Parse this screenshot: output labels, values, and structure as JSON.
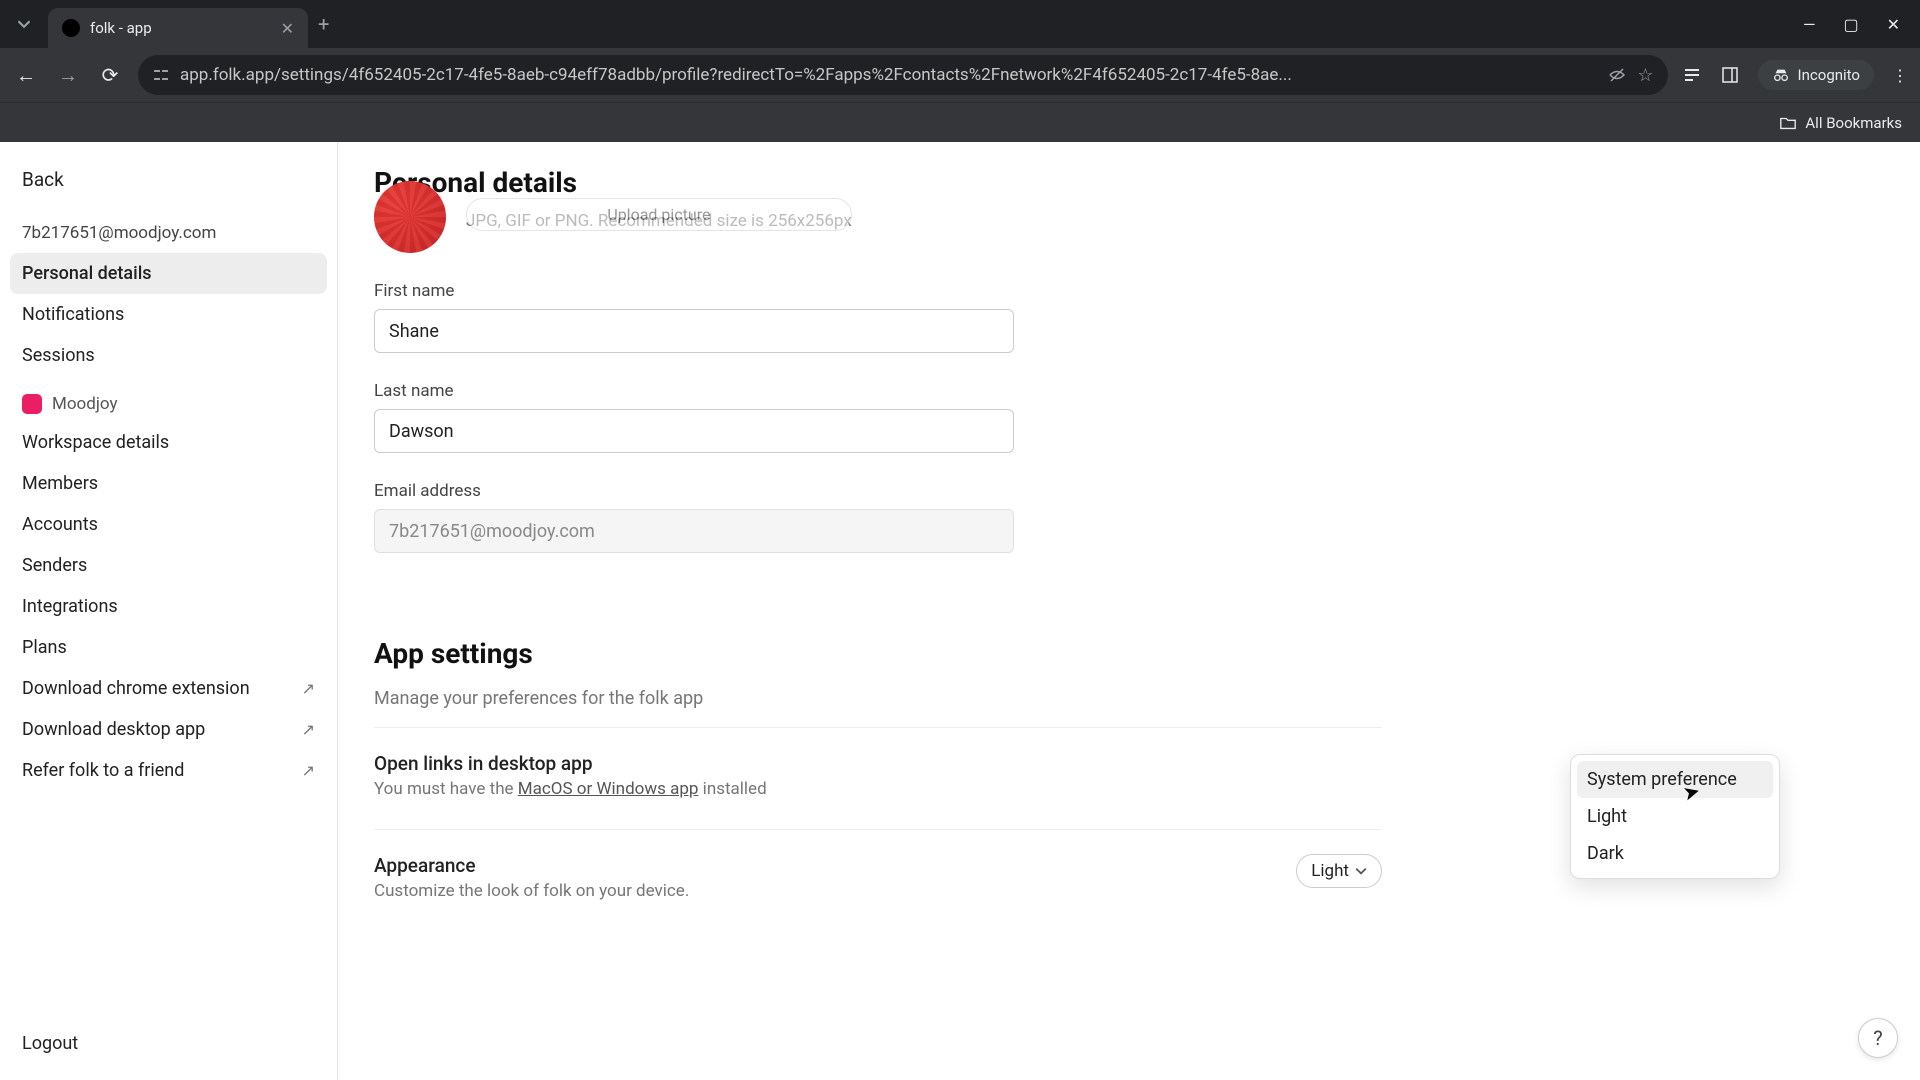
{
  "browser": {
    "tab_title": "folk - app",
    "url": "app.folk.app/settings/4f652405-2c17-4fe5-8aeb-c94eff78adbb/profile?redirectTo=%2Fapps%2Fcontacts%2Fnetwork%2F4f652405-2c17-4fe5-8ae...",
    "incognito_label": "Incognito",
    "bookmarks_label": "All Bookmarks"
  },
  "sidebar": {
    "back": "Back",
    "account_email": "7b217651@moodjoy.com",
    "items_account": [
      {
        "label": "Personal details",
        "active": true
      },
      {
        "label": "Notifications",
        "active": false
      },
      {
        "label": "Sessions",
        "active": false
      }
    ],
    "workspace_name": "Moodjoy",
    "items_workspace": [
      {
        "label": "Workspace details",
        "external": false
      },
      {
        "label": "Members",
        "external": false
      },
      {
        "label": "Accounts",
        "external": false
      },
      {
        "label": "Senders",
        "external": false
      },
      {
        "label": "Integrations",
        "external": false
      },
      {
        "label": "Plans",
        "external": false
      },
      {
        "label": "Download chrome extension",
        "external": true
      },
      {
        "label": "Download desktop app",
        "external": true
      },
      {
        "label": "Refer folk to a friend",
        "external": true
      }
    ],
    "logout": "Logout"
  },
  "main": {
    "personal_details_title": "Personal details",
    "upload_button": "Upload picture",
    "upload_hint": "JPG, GIF or PNG. Recommended size is 256x256px",
    "first_name_label": "First name",
    "first_name_value": "Shane",
    "last_name_label": "Last name",
    "last_name_value": "Dawson",
    "email_label": "Email address",
    "email_value": "7b217651@moodjoy.com",
    "app_settings_title": "App settings",
    "app_settings_sub": "Manage your preferences for the folk app",
    "open_links_title": "Open links in desktop app",
    "open_links_desc_prefix": "You must have the ",
    "open_links_link": "MacOS or Windows app",
    "open_links_desc_suffix": " installed",
    "appearance_title": "Appearance",
    "appearance_desc": "Customize the look of folk on your device.",
    "appearance_value": "Light",
    "appearance_options": [
      "System preference",
      "Light",
      "Dark"
    ]
  },
  "help": "?"
}
